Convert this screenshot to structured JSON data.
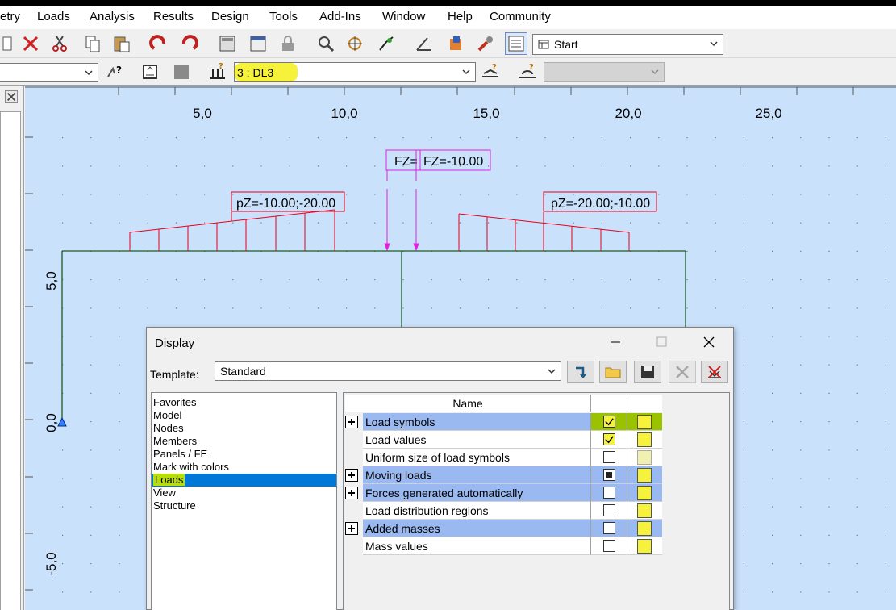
{
  "menu": [
    "etry",
    "Loads",
    "Analysis",
    "Results",
    "Design",
    "Tools",
    "Add-Ins",
    "Window",
    "Help",
    "Community"
  ],
  "toolbar": {
    "view_combo": "Start",
    "loadcase_combo": "3 : DL3",
    "left_combo": ""
  },
  "canvas": {
    "x_ticks": [
      "5,0",
      "10,0",
      "15,0",
      "20,0",
      "25,0"
    ],
    "y_ticks": [
      "5,0",
      "0,0",
      "-5,0"
    ],
    "load_labels": {
      "fz_left": "FZ=",
      "fz_right": "FZ=-10.00",
      "pz_left": "pZ=-10.00;-20.00",
      "pz_right": "pZ=-20.00;-10.00"
    },
    "colors": {
      "background": "#c9e1fb",
      "member_load": "#e8001c",
      "nodal_load": "#e020e0",
      "structure": "#1a5c2a"
    }
  },
  "dialog": {
    "title": "Display",
    "template_label": "Template:",
    "template_value": "Standard",
    "categories": [
      "Favorites",
      "Model",
      "Nodes",
      "Members",
      "Panels / FE",
      "Mark with colors",
      "Loads",
      "View",
      "Structure"
    ],
    "selected_category": "Loads",
    "grid_header": "Name",
    "rows": [
      {
        "name": "Load symbols",
        "group": true,
        "checked": true,
        "icon": "load-symbols-icon"
      },
      {
        "name": "Load values",
        "group": false,
        "checked": true,
        "icon": "load-values-icon"
      },
      {
        "name": "Uniform size of load symbols",
        "group": false,
        "checked": false,
        "icon": "uniform-size-icon"
      },
      {
        "name": "Moving loads",
        "group": true,
        "checked": "partial",
        "icon": "moving-loads-icon"
      },
      {
        "name": "Forces generated automatically",
        "group": true,
        "checked": false,
        "icon": "generated-forces-icon"
      },
      {
        "name": "Load distribution regions",
        "group": false,
        "checked": false,
        "icon": "distribution-regions-icon"
      },
      {
        "name": "Added masses",
        "group": true,
        "checked": false,
        "icon": "added-masses-icon"
      },
      {
        "name": "Mass values",
        "group": false,
        "checked": false,
        "icon": "mass-values-icon"
      }
    ]
  }
}
